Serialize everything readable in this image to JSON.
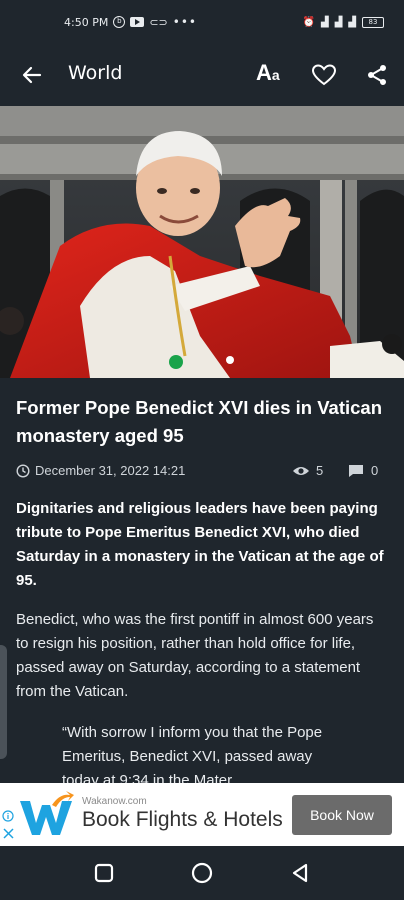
{
  "status_bar": {
    "time": "4:50 PM",
    "left_icons": [
      "b-circle-icon",
      "youtube-icon",
      "link-icon",
      "more-dots-icon"
    ],
    "right_icons": [
      "alarm-icon",
      "wifi-signal-icon",
      "cell-signal-icon",
      "cell-signal-2-icon",
      "battery-icon"
    ],
    "battery": "83"
  },
  "app_bar": {
    "title": "World",
    "font_size_label_big": "A",
    "font_size_label_small": "a"
  },
  "article": {
    "headline": "Former Pope Benedict XVI dies in Vatican monastery aged 95",
    "date": "December 31, 2022 14:21",
    "views": "5",
    "comments": "0",
    "lead": "Dignitaries and religious leaders have been paying tribute to Pope Emeritus Benedict XVI, who died Saturday in a monastery in the Vatican at the age of 95.",
    "paragraph": "Benedict, who was the first pontiff in almost 600 years to resign his position, rather than hold office for life, passed away on Saturday, according to a statement from the Vatican.",
    "quote": "“With sorrow I inform you that the Pope Emeritus, Benedict XVI, passed away today at 9:34 in the Mater"
  },
  "ad": {
    "domain": "Wakanow.com",
    "headline": "Book Flights & Hotels",
    "cta": "Book Now"
  },
  "colors": {
    "background": "#1f262d",
    "ad_cta": "#6b6b6b",
    "logo_blue": "#1ea3e0",
    "logo_orange": "#f7941d"
  }
}
